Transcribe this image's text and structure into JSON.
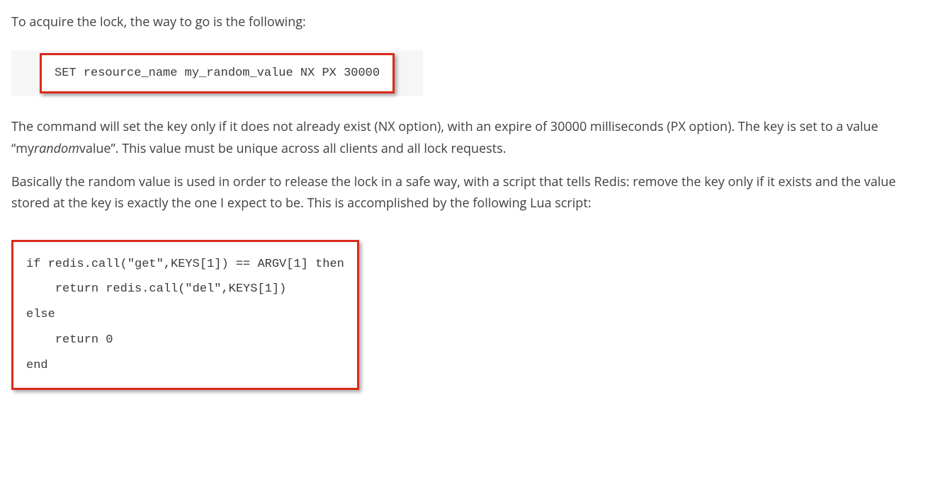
{
  "paragraphs": {
    "p1": "To acquire the lock, the way to go is the following:",
    "p2_part1": "The command will set the key only if it does not already exist (NX option), with an expire of 30000 milliseconds (PX option). The key is set to a value “my",
    "p2_italic": "random",
    "p2_part2": "value”. This value must be unique across all clients and all lock requests.",
    "p3": "Basically the random value is used in order to release the lock in a safe way, with a script that tells Redis: remove the key only if it exists and the value stored at the key is exactly the one I expect to be. This is accomplished by the following Lua script:"
  },
  "code": {
    "set_command": "SET resource_name my_random_value NX PX 30000",
    "lua_script": "if redis.call(″get″,KEYS[1]) == ARGV[1] then\n    return redis.call(″del″,KEYS[1])\nelse\n    return 0\nend"
  }
}
